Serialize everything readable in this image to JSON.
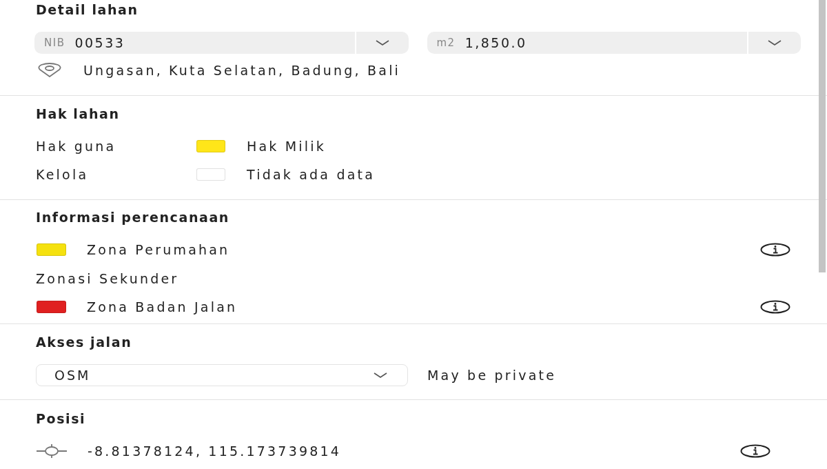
{
  "sections": [
    {
      "kind": "detail",
      "title": "Detail lahan",
      "fields": [
        {
          "prefix": "NIB",
          "value": "00533"
        },
        {
          "prefix": "m2",
          "value": "1,850.0"
        }
      ],
      "location": "Ungasan, Kuta Selatan, Badung, Bali"
    },
    {
      "kind": "rights",
      "title": "Hak lahan",
      "rows": [
        {
          "label": "Hak guna",
          "legend": "Hak Milik",
          "color": "#ffe619"
        },
        {
          "label": "Kelola",
          "legend": "Tidak ada data",
          "color": "#ffffff"
        }
      ]
    },
    {
      "kind": "planning",
      "title": "Informasi perencanaan",
      "items": [
        {
          "kind": "zone",
          "label": "Zona Perumahan",
          "color": "#f5e10f"
        },
        {
          "kind": "heading",
          "label": "Zonasi Sekunder"
        },
        {
          "kind": "zone",
          "label": "Zona Badan Jalan",
          "color": "#e02020"
        }
      ]
    },
    {
      "kind": "access",
      "title": "Akses jalan",
      "select": "OSM",
      "note": "May be private"
    },
    {
      "kind": "position",
      "title": "Posisi",
      "coords": "-8.81378124, 115.173739814"
    }
  ]
}
